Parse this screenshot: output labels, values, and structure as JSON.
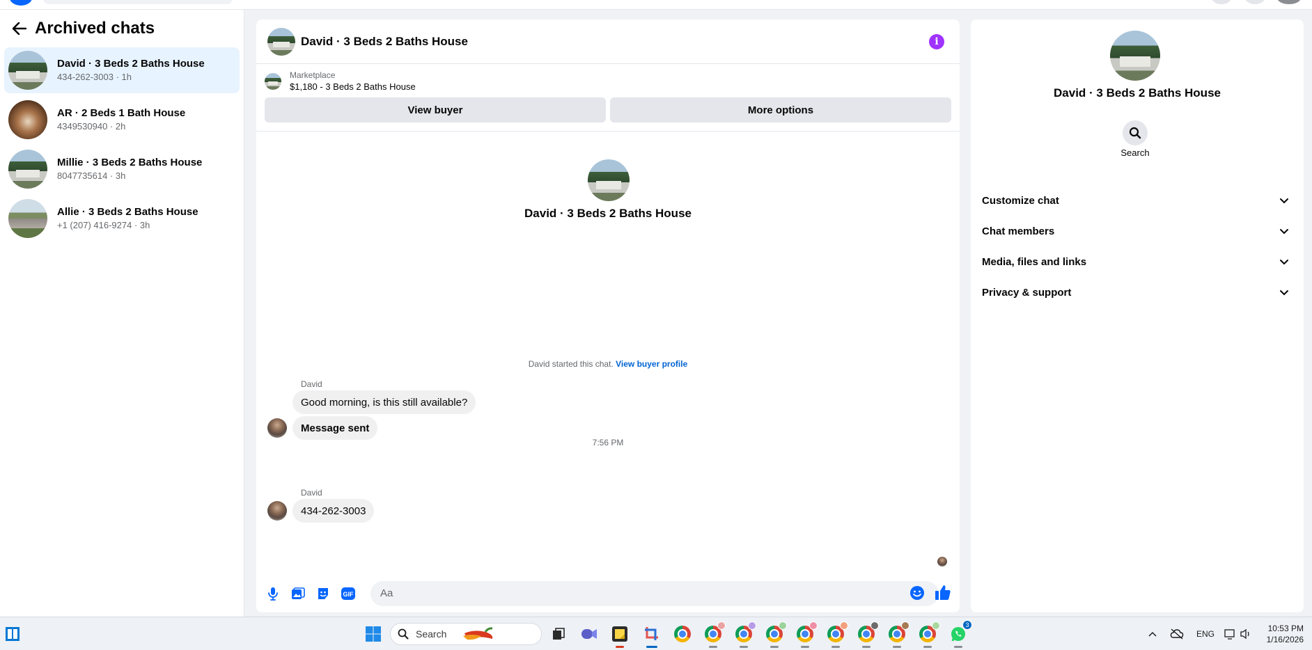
{
  "sidebar": {
    "title": "Archived chats",
    "chats": [
      {
        "name": "David · 3 Beds 2 Baths House",
        "sub": "434-262-3003 · 1h"
      },
      {
        "name": "AR · 2 Beds 1 Bath House",
        "sub": "4349530940 · 2h"
      },
      {
        "name": "Millie · 3 Beds 2 Baths House",
        "sub": "8047735614 · 3h"
      },
      {
        "name": "Allie · 3 Beds 2 Baths House",
        "sub": "+1 (207) 416-9274 · 3h"
      }
    ]
  },
  "conversation": {
    "header_title": "David · 3 Beds 2 Baths House",
    "marketplace_label": "Marketplace",
    "listing": "$1,180 - 3 Beds 2 Baths House",
    "view_buyer": "View buyer",
    "more_options": "More options",
    "profile_name": "David · 3 Beds 2 Baths House",
    "started_text": "David started this chat.",
    "view_buyer_profile": "View buyer profile",
    "messages": [
      {
        "sender": "David",
        "text": "Good morning, is this still available?"
      },
      {
        "text": "Message sent"
      },
      {
        "sender": "David",
        "text": "434-262-3003"
      }
    ],
    "timestamp": "7:56 PM",
    "composer_placeholder": "Aa"
  },
  "details": {
    "name": "David · 3 Beds 2 Baths House",
    "search_label": "Search",
    "sections": [
      "Customize chat",
      "Chat members",
      "Media, files and links",
      "Privacy & support"
    ]
  },
  "taskbar": {
    "search_label": "Search",
    "language": "ENG",
    "time": "10:53 PM",
    "date": "1/16/2026",
    "whatsapp_badge": "3"
  },
  "colors": {
    "accent": "#0866ff",
    "info": "#a033ff",
    "active_row": "#e7f3ff"
  }
}
